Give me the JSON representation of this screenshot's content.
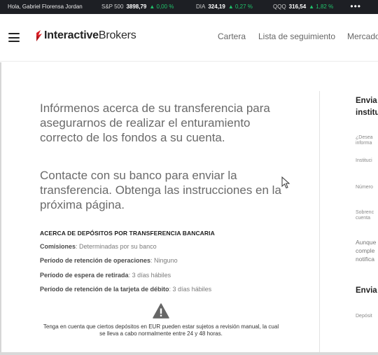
{
  "ticker": {
    "greeting": "Hola, Gabriel Florensa Jordan",
    "items": [
      {
        "symbol": "S&P 500",
        "value": "3898,79",
        "change": "▲ 0,00 %"
      },
      {
        "symbol": "DIA",
        "value": "324,19",
        "change": "▲ 0,27 %"
      },
      {
        "symbol": "QQQ",
        "value": "316,54",
        "change": "▲ 1,82 %"
      }
    ],
    "more": "•••"
  },
  "header": {
    "brand_bold": "Interactive",
    "brand_rest": "Brokers",
    "nav": [
      "Cartera",
      "Lista de seguimiento",
      "Mercado"
    ]
  },
  "main": {
    "intro_1": "Infórmenos acerca de su transferencia para asegurarnos de realizar el enturamiento correcto de los fondos a su cuenta.",
    "intro_2": "Contacte con su banco para enviar la transferencia. Obtenga las instrucciones en la próxima página.",
    "section_title": "ACERCA DE DEPÓSITOS POR TRANSFERENCIA BANCARIA",
    "rows": [
      {
        "label": "Comisiones",
        "value": ": Determinadas por su banco"
      },
      {
        "label": "Período de retención de operaciones",
        "value": ": Ninguno"
      },
      {
        "label": "Período de espera de retirada",
        "value": ": 3 días hábiles"
      },
      {
        "label": "Período de retención de la tarjeta de débito",
        "value": ": 3 días hábiles"
      }
    ],
    "warning": "Tenga en cuenta que ciertos depósitos en EUR pueden estar sujetos a revisión manual, la cual se lleva a cabo normalmente entre 24 y 48 horas."
  },
  "right": {
    "title_1_line1": "Envia",
    "title_1_line2": "institu",
    "q1_line1": "¿Desea",
    "q1_line2": "informa",
    "field_1": "Instituci",
    "field_2": "Número",
    "field_3_line1": "Sobrenc",
    "field_3_line2": "cuenta",
    "note_line1": "Aunque",
    "note_line2": "comple",
    "note_line3": "notifica",
    "title_2": "Envia",
    "field_4": "Depósit"
  }
}
